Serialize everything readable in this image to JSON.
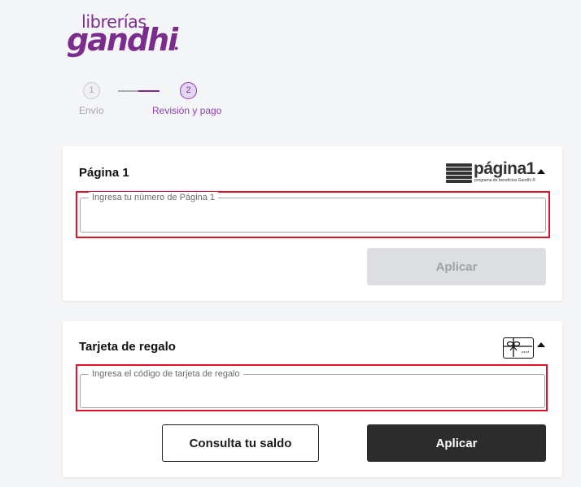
{
  "brand": {
    "line1": "librerías",
    "line2": "gandhi",
    "color": "#7b2d8e"
  },
  "stepper": {
    "steps": [
      {
        "number": "1",
        "label": "Envío",
        "state": "completed"
      },
      {
        "number": "2",
        "label": "Revisión y pago",
        "state": "active"
      }
    ]
  },
  "pagina1": {
    "title": "Página 1",
    "logo_text": "página1",
    "logo_subtext": "programa de beneficios Gandhi ®",
    "field_label": "Ingresa tu número de Página 1",
    "field_value": "",
    "apply_label": "Aplicar",
    "icon": "pagina1-logo-icon"
  },
  "gift_card": {
    "title": "Tarjeta de regalo",
    "field_label": "Ingresa el código de tarjeta de regalo",
    "field_value": "",
    "balance_label": "Consulta tu saldo",
    "apply_label": "Aplicar",
    "icon": "gift-card-icon"
  },
  "colors": {
    "accent": "#7b2d8e",
    "highlight": "#e0122b",
    "dark_button": "#2d2c2c",
    "disabled_button": "#dcdee1"
  }
}
